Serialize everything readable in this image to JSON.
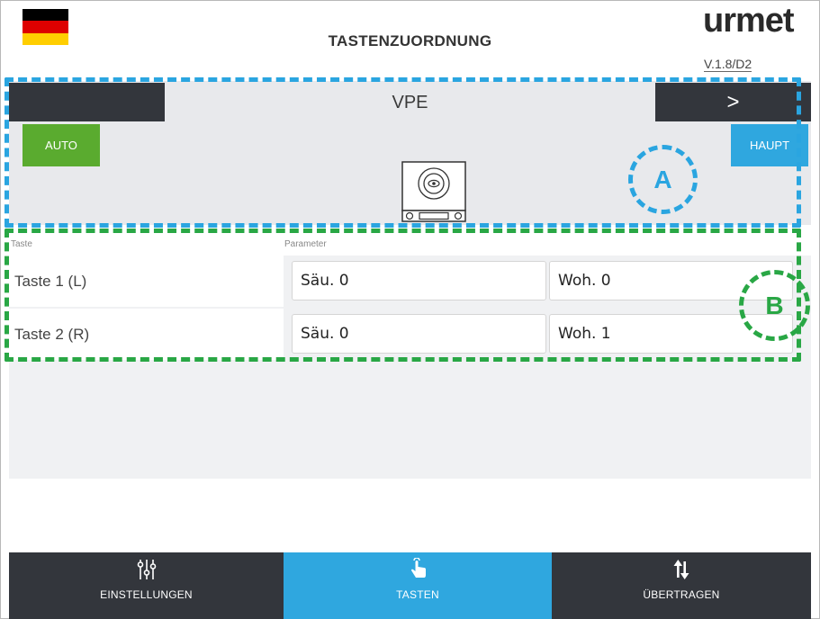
{
  "header": {
    "title": "TASTENZUORDNUNG",
    "brand": "urmet",
    "version": "V.1.8/D2",
    "flag_colors": [
      "#000000",
      "#dd0000",
      "#ffce00"
    ]
  },
  "panel": {
    "title": "VPE",
    "next_label": ">",
    "auto_label": "AUTO",
    "haupt_label": "HAUPT",
    "device_icon": "camera-panel-icon"
  },
  "columns": {
    "taste": "Taste",
    "parameter": "Parameter"
  },
  "rows": [
    {
      "key": "Taste 1 (L)",
      "param1": "Säu. 0",
      "param2": "Woh. 0"
    },
    {
      "key": "Taste 2 (R)",
      "param1": "Säu. 0",
      "param2": "Woh. 1"
    }
  ],
  "callouts": {
    "a": "A",
    "b": "B",
    "a_color": "#2aa5e0",
    "b_color": "#29a745"
  },
  "tabs": [
    {
      "label": "EINSTELLUNGEN",
      "icon": "sliders-icon"
    },
    {
      "label": "TASTEN",
      "icon": "hand-tap-icon",
      "active": true
    },
    {
      "label": "ÜBERTRAGEN",
      "icon": "transfer-arrows-icon"
    }
  ],
  "colors": {
    "auto_green": "#5aab2f",
    "accent_blue": "#2fa7df",
    "dark": "#33363c"
  }
}
